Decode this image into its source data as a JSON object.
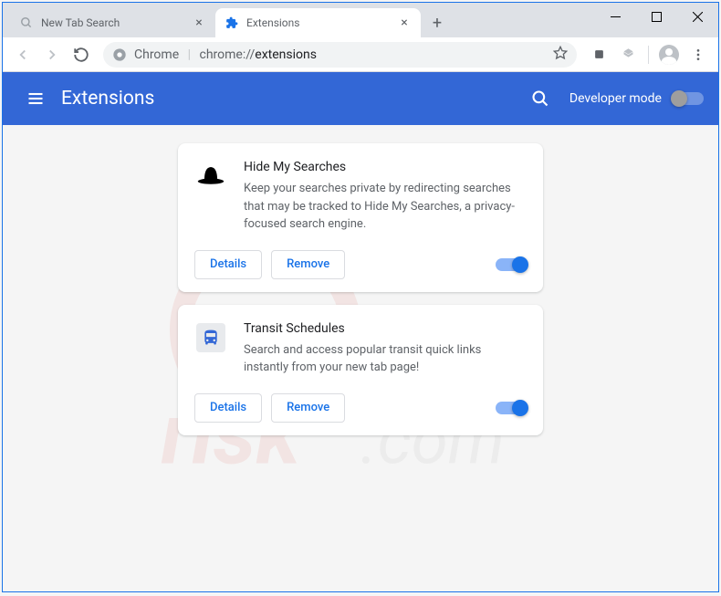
{
  "tabs": [
    {
      "title": "New Tab Search",
      "active": false
    },
    {
      "title": "Extensions",
      "active": true
    }
  ],
  "omnibox": {
    "label": "Chrome",
    "path_prefix": "chrome://",
    "path_bold": "extensions"
  },
  "header": {
    "title": "Extensions",
    "dev_mode_label": "Developer mode"
  },
  "extensions": [
    {
      "name": "Hide My Searches",
      "description": "Keep your searches private by redirecting searches that may be tracked to Hide My Searches, a privacy-focused search engine.",
      "details_label": "Details",
      "remove_label": "Remove",
      "enabled": true,
      "icon": "hat"
    },
    {
      "name": "Transit Schedules",
      "description": "Search and access popular transit quick links instantly from your new tab page!",
      "details_label": "Details",
      "remove_label": "Remove",
      "enabled": true,
      "icon": "bus"
    }
  ]
}
